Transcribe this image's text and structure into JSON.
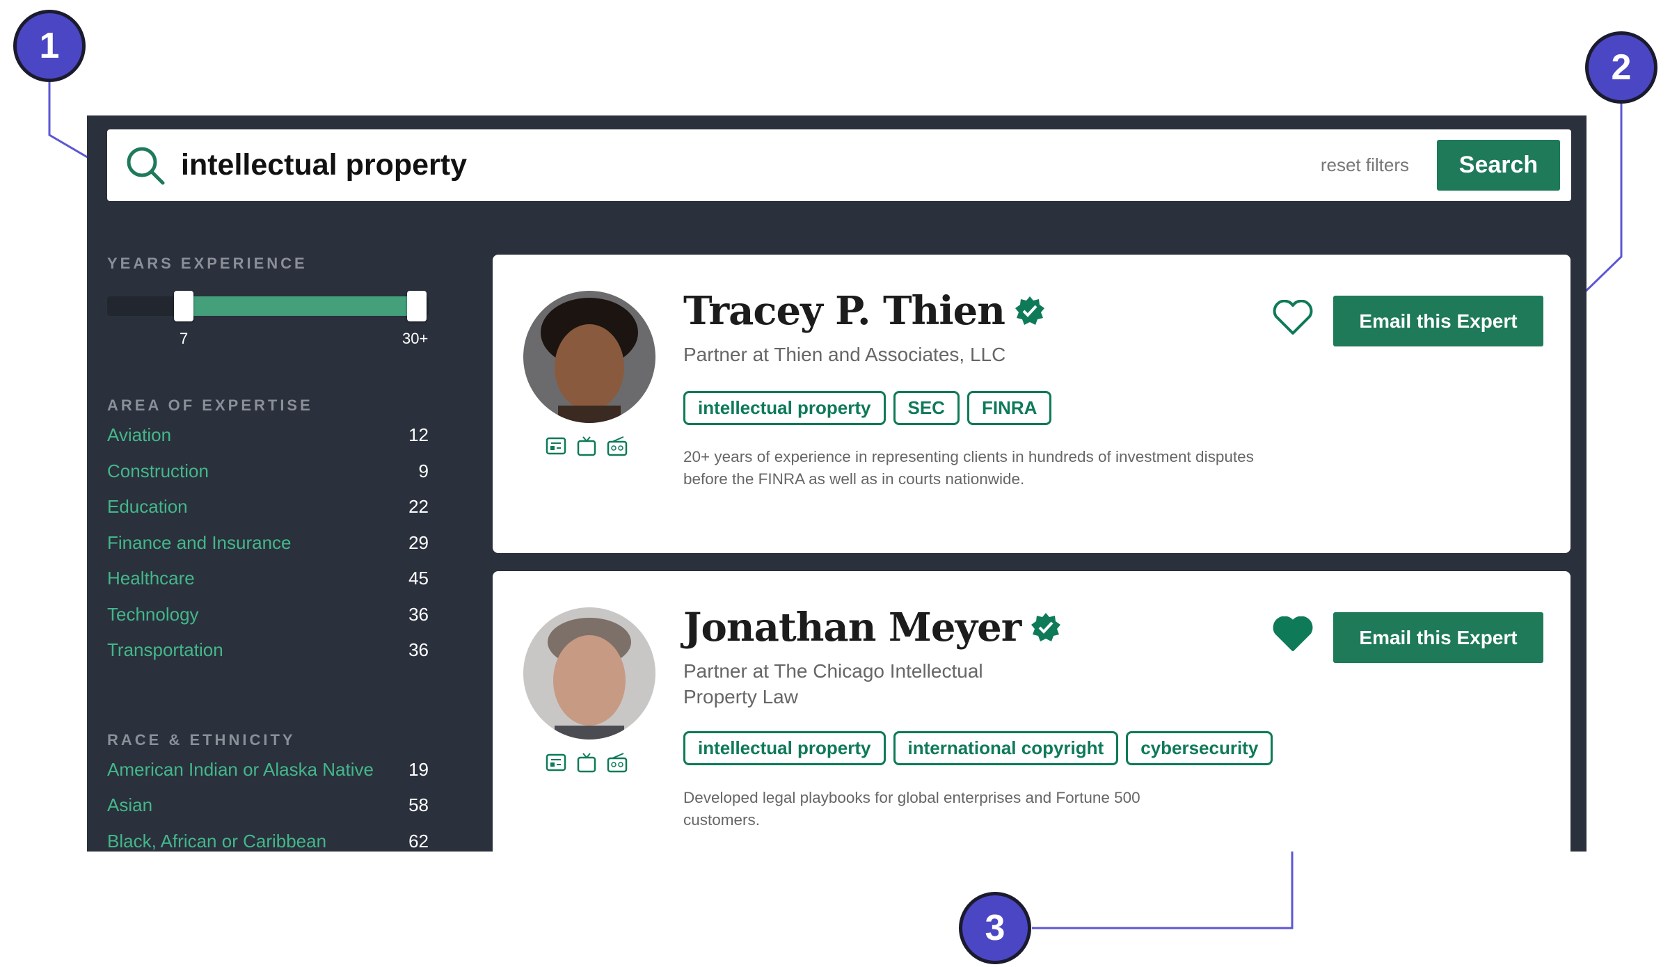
{
  "search": {
    "query": "intellectual property",
    "reset_label": "reset filters",
    "button_label": "Search"
  },
  "filters": {
    "years": {
      "heading": "YEARS EXPERIENCE",
      "min_label": "7",
      "max_label": "30+",
      "min": 7,
      "max": 30
    },
    "expertise": {
      "heading": "AREA OF EXPERTISE",
      "items": [
        {
          "label": "Aviation",
          "count": "12"
        },
        {
          "label": "Construction",
          "count": "9"
        },
        {
          "label": "Education",
          "count": "22"
        },
        {
          "label": "Finance and Insurance",
          "count": "29"
        },
        {
          "label": "Healthcare",
          "count": "45"
        },
        {
          "label": "Technology",
          "count": "36"
        },
        {
          "label": "Transportation",
          "count": "36"
        }
      ]
    },
    "race": {
      "heading": "RACE & ETHNICITY",
      "items": [
        {
          "label": "American Indian or Alaska Native",
          "count": "19"
        },
        {
          "label": "Asian",
          "count": "58"
        },
        {
          "label": "Black, African or Caribbean",
          "count": "62"
        }
      ]
    }
  },
  "experts": [
    {
      "name": "Tracey P. Thien",
      "title": "Partner at Thien and Associates, LLC",
      "tags": [
        "intellectual property",
        "SEC",
        "FINRA"
      ],
      "description": "20+ years of experience in representing clients in hundreds of investment disputes before the FINRA as well as in courts nationwide.",
      "favorited": false,
      "email_label": "Email this Expert"
    },
    {
      "name": "Jonathan Meyer",
      "title": "Partner at The Chicago Intellectual Property Law",
      "tags": [
        "intellectual property",
        "international copyright",
        "cybersecurity"
      ],
      "description": "Developed legal playbooks for global enterprises and Fortune 500 customers.",
      "favorited": true,
      "email_label": "Email this Expert"
    }
  ],
  "callouts": [
    "1",
    "2",
    "3"
  ],
  "colors": {
    "accent": "#1e7a59",
    "panel": "#2a303c",
    "callout": "#4a46c4",
    "link": "#43b78a"
  }
}
